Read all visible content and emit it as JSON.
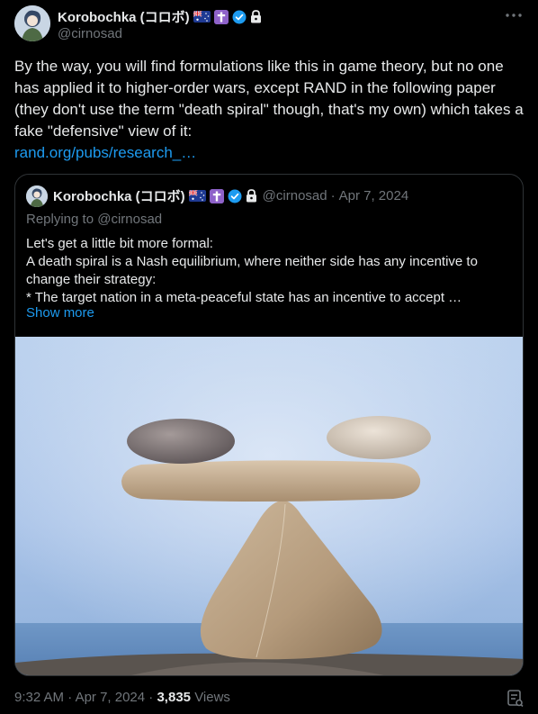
{
  "author": {
    "name": "Korobochka (コロボ)",
    "handle": "@cirnosad"
  },
  "icons": {
    "flag": "australia-flag-emoji",
    "cross": "latin-cross-emoji",
    "verified": "verified-badge-icon",
    "lock": "lock-icon",
    "more": "more-options-icon",
    "analytics": "analytics-icon"
  },
  "colors": {
    "background": "#000000",
    "text": "#e7e9ea",
    "muted": "#71767b",
    "link": "#1d9bf0",
    "border": "#2f3336"
  },
  "tweet": {
    "text": "By the way, you will find formulations like this in game theory, but no one has applied it to higher-order wars, except RAND in the following paper (they don't use the term \"death spiral\" though, that's my own) which takes a fake \"defensive\" view of it:",
    "link": "rand.org/pubs/research_…"
  },
  "quote": {
    "name": "Korobochka (コロボ)",
    "handle": "@cirnosad",
    "separator": "·",
    "date": "Apr 7, 2024",
    "replying_to": "Replying to @cirnosad",
    "text": "Let's get a little bit more formal:\nA death spiral is a Nash equilibrium, where neither side has any incentive to change their strategy:\n* The target nation in a meta-peaceful state has an incentive to accept …",
    "show_more": "Show more"
  },
  "meta": {
    "time": "9:32 AM",
    "separator": "·",
    "date": "Apr 7, 2024",
    "separator2": "·",
    "views_count": "3,835",
    "views_label": "Views"
  }
}
